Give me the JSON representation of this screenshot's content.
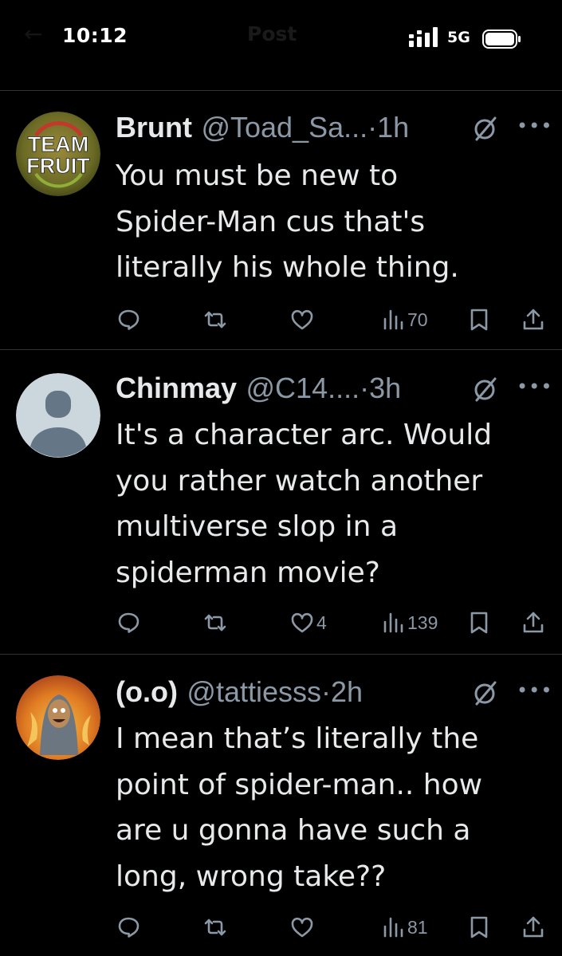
{
  "status_bar": {
    "time": "10:12",
    "network": "5G",
    "signal_icon": "signal-bars-icon",
    "battery_icon": "battery-icon"
  },
  "behind_header": {
    "title": "Post",
    "back_icon": "back-arrow-icon"
  },
  "colors": {
    "background": "#000000",
    "text": "#e7e9ea",
    "secondary": "#8b98a5",
    "divider": "#2f3336"
  },
  "replies": [
    {
      "display_name": "Brunt",
      "handle": "@Toad_Sa...",
      "separator": "·",
      "time": "1h",
      "avatar_text_top": "TEAM",
      "avatar_text_bottom": "FRUIT",
      "text_lines": [
        "You must be new to",
        "Spider-Man cus that's",
        "literally his whole thing."
      ],
      "likes": "",
      "views": "70"
    },
    {
      "display_name": "Chinmay",
      "handle": "@C14....",
      "separator": "·",
      "time": "3h",
      "text_lines": [
        "It's a character arc. Would",
        "you rather watch another",
        "multiverse slop in a",
        "spiderman movie?"
      ],
      "likes": "4",
      "views": "139"
    },
    {
      "display_name": "(o.o)",
      "handle": "@tattiesss",
      "separator": "·",
      "time": "2h",
      "text_lines": [
        "I mean that’s literally the",
        "point of spider-man.. how",
        "are u gonna have such a",
        "long, wrong take??"
      ],
      "likes": "",
      "views": "81"
    }
  ],
  "action_icons": [
    "reply-icon",
    "repost-icon",
    "like-icon",
    "views-icon",
    "bookmark-icon",
    "share-icon"
  ]
}
